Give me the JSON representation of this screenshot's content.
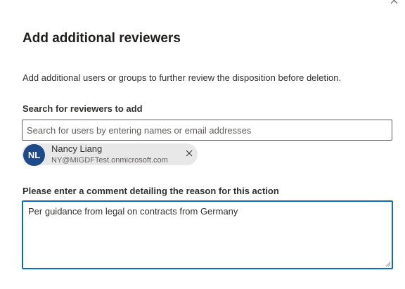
{
  "dialog": {
    "title": "Add additional reviewers",
    "description": "Add additional users or groups to further review the disposition before deletion.",
    "close_icon": "close-icon"
  },
  "search": {
    "label": "Search for reviewers to add",
    "placeholder": "Search for users by entering names or email addresses",
    "value": ""
  },
  "selected_reviewers": [
    {
      "initials": "NL",
      "name": "Nancy Liang",
      "email": "NY@MIGDFTest.onmicrosoft.com",
      "avatar_color": "#1e4a8a",
      "remove_icon": "close-icon"
    }
  ],
  "comment": {
    "label": "Please enter a comment detailing the reason for this action",
    "value": "Per guidance from legal on contracts from Germany"
  },
  "colors": {
    "focus_border": "#0f6cbd",
    "persona_background": "#e8e8e8",
    "avatar": "#1e4a8a"
  }
}
